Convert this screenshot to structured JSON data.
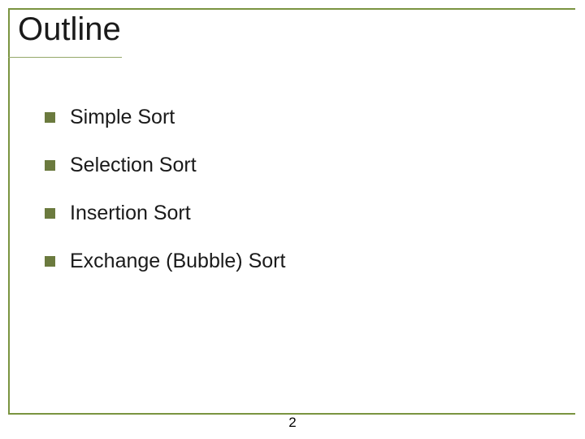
{
  "slide": {
    "title": "Outline",
    "bullets": [
      "Simple Sort",
      "Selection Sort",
      "Insertion Sort",
      "Exchange (Bubble) Sort"
    ],
    "page_number": "2"
  }
}
